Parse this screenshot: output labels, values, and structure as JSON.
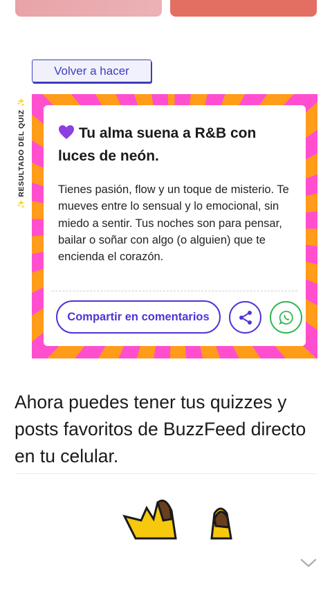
{
  "top_cards": {
    "left_color": "#e8a3a8",
    "right_color": "#e36f63"
  },
  "retry": {
    "label": "Volver a hacer"
  },
  "result": {
    "side_label": "RESULTADO DEL QUIZ",
    "side_icon": "sparkle-icon",
    "title_icon": "purple-heart-icon",
    "title": "Tu alma suena a R&B con luces de neón.",
    "body": "Tienes pasión, flow y un toque de misterio. Te mueves entre lo sensual y lo emocional, sin miedo a sentir. Tus noches son para pensar, bailar o soñar con algo (o alguien) que te encienda el corazón.",
    "share_comments_label": "Compartir en comentarios",
    "share_icon": "share-icon",
    "whatsapp_icon": "whatsapp-icon",
    "colors": {
      "pink": "#ff4fcf",
      "orange": "#ff9c1a",
      "accent": "#4c36d6",
      "whatsapp": "#2fb84d"
    }
  },
  "promo": {
    "text": "Ahora puedes tener tus quizzes y posts favoritos de BuzzFeed directo en tu celular."
  },
  "bottom": {
    "chevron_icon": "chevron-down-icon"
  }
}
